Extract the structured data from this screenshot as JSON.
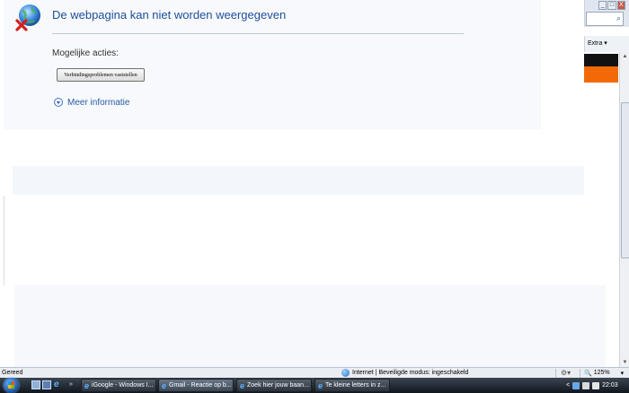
{
  "error_page": {
    "title": "De webpagina kan niet worden weergegeven",
    "actions_label": "Mogelijke acties:",
    "diagnose_button": "Verbindingsproblemen vaststellen",
    "more_info": "Meer informatie"
  },
  "browser_chrome": {
    "extra_menu": "Extra ▾",
    "search_icon": "search-icon",
    "window_controls": [
      "_",
      "□",
      "X"
    ]
  },
  "status_bar": {
    "left_text": "Gereed",
    "zone_text": "Internet | Beveiligde modus: ingeschakeld",
    "zoom": "125%",
    "zoom_arrow": "▾"
  },
  "taskbar": {
    "windows": [
      {
        "label": "iGoogle - Windows I...",
        "icon": "ie-icon"
      },
      {
        "label": "Gmail - Reactie op b...",
        "icon": "ie-icon"
      },
      {
        "label": "Zoek hier jouw baan...",
        "icon": "ie-icon"
      },
      {
        "label": "Te kleine letters in z...",
        "icon": "ie-icon"
      }
    ],
    "clock": "22:03",
    "tray_arrow": "<"
  },
  "colors": {
    "title_blue": "#1f4e9b",
    "link_blue": "#2a5aa6",
    "orange_band": "#f26a08"
  }
}
